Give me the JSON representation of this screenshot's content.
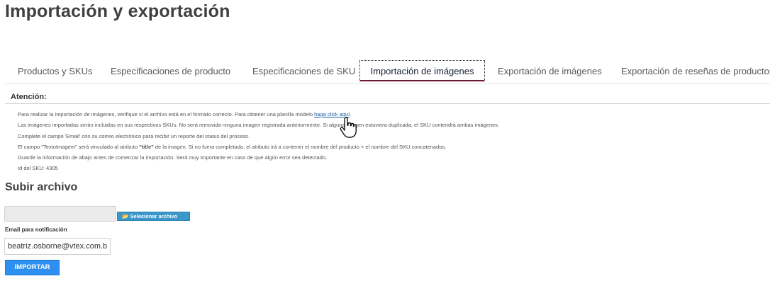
{
  "page": {
    "title": "Importación y exportación"
  },
  "tabs": [
    {
      "label": "Productos y SKUs",
      "active": false
    },
    {
      "label": "Especificaciones de producto",
      "active": false
    },
    {
      "label": "Especificaciones de SKU",
      "active": false
    },
    {
      "label": "Importación de imágenes",
      "active": true
    },
    {
      "label": "Exportación de imágenes",
      "active": false
    },
    {
      "label": "Exportación de reseñas de productos",
      "active": false
    }
  ],
  "attention": {
    "title": "Atención:",
    "line1_text": "Para realizar la importación de imágenes, verifique si el archivo está en el formato correcto. Para obtener una planilla modelo ",
    "line1_link": "haga click aquí",
    "line1_end": ".",
    "line2": "Las imágenes importadas serán incluidas en sus respectivos SKUs. No será removida ninguna imagen registrada anteriormente. Si alguna imagen estuviera duplicada, el SKU contendrá ambas imágenes.",
    "line3": "Complete el campo 'Email' con su correo electrónico para recibir un reporte del status del proceso.",
    "line4_a": "El campo \"TextoImagem\" será vinculado al atributo ",
    "line4_b": "\"title\"",
    "line4_c": " de la imagen. Si no fuera completado, el atributo irá a contener el nombre del producto + el nombre del SKU concatenados.",
    "line5": "Guarde la información de abajo antes de comenzar la importación. Será muy importante en caso de que algún error sea detectado.",
    "line6": "Id del SKU: 4305"
  },
  "upload": {
    "title": "Subir archivo",
    "select_button_label": "Selecionar archivo",
    "email_label": "Email para notificación",
    "email_value": "beatriz.osborne@vtex.com.br",
    "import_button_label": "IMPORTAR"
  },
  "colors": {
    "active_tab_underline": "#6d1a33",
    "select_button": "#3b97c9",
    "import_button": "#2d8ff0",
    "link": "#1a5fa8"
  },
  "icons": {
    "folder": "folder-icon",
    "cursor": "hand-pointer-icon"
  }
}
